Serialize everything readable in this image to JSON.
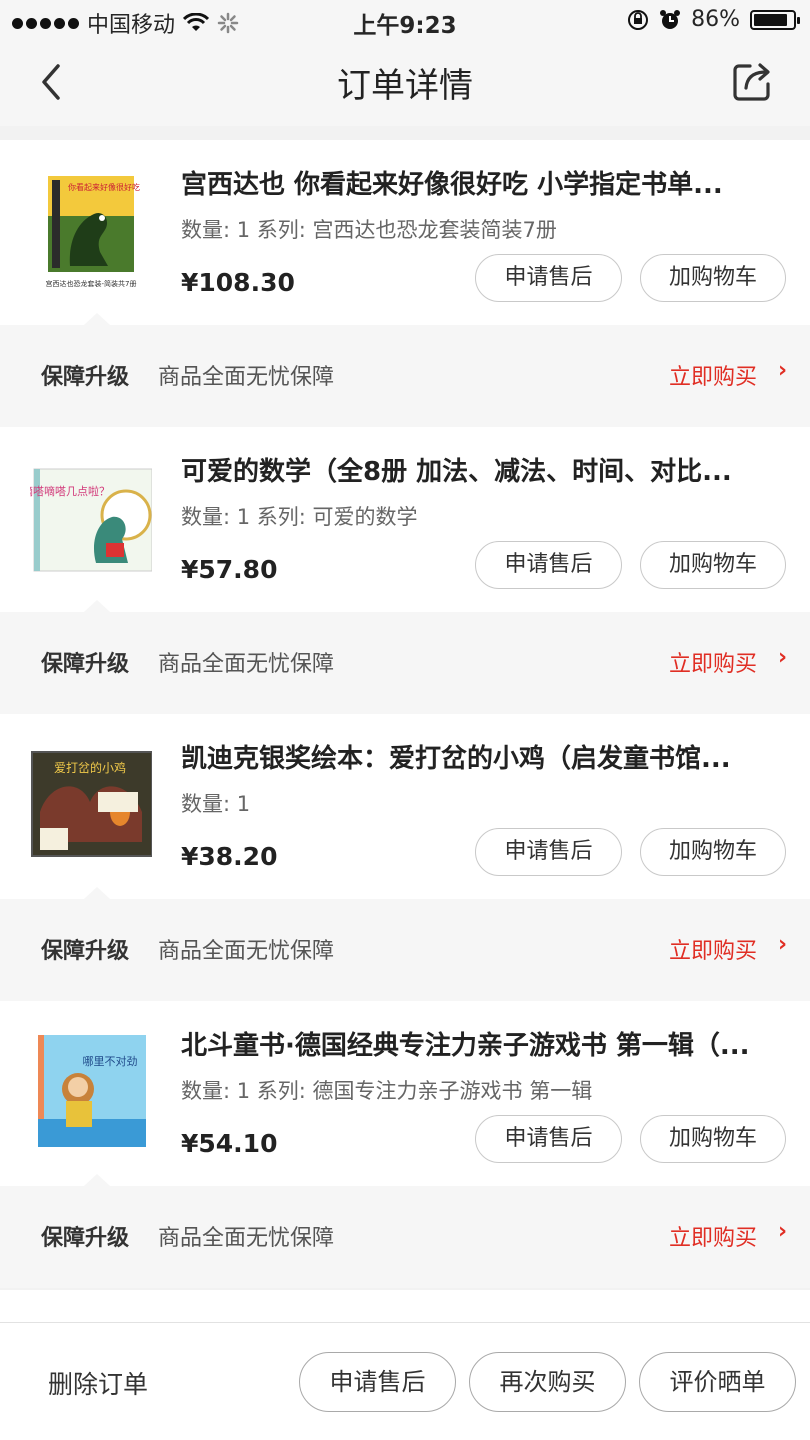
{
  "status": {
    "carrier": "中国移动",
    "time": "上午9:23",
    "battery": "86%",
    "battery_level": 0.86
  },
  "header": {
    "title": "订单详情"
  },
  "items": [
    {
      "name": "宫西达也 你看起来好像很好吃  小学指定书单...",
      "meta": "数量: 1 系列: 宫西达也恐龙套装简装7册",
      "price": "¥108.30",
      "thumb_caption": "宫西达也恐龙套装-简装共7册",
      "cover_text": "你看起来好像很好吃"
    },
    {
      "name": "可爱的数学（全8册 加法、减法、时间、对比...",
      "meta": "数量: 1 系列: 可爱的数学",
      "price": "¥57.80",
      "cover_text": "嘀嗒嘀嗒几点啦？"
    },
    {
      "name": "凯迪克银奖绘本：爱打岔的小鸡（启发童书馆...",
      "meta": "数量: 1",
      "price": "¥38.20",
      "cover_text": "爱打岔的小鸡"
    },
    {
      "name": "北斗童书·德国经典专注力亲子游戏书 第一辑（...",
      "meta": "数量: 1 系列: 德国专注力亲子游戏书 第一辑",
      "price": "¥54.10",
      "cover_text": "哪里不对劲"
    }
  ],
  "item_actions": {
    "after_sale": "申请售后",
    "add_cart": "加购物车"
  },
  "guarantee": {
    "label": "保障升级",
    "desc": "商品全面无忧保障",
    "buy": "立即购买"
  },
  "footer": {
    "delete": "删除订单",
    "after_sale": "申请售后",
    "rebuy": "再次购买",
    "review": "评价晒单"
  },
  "colors": {
    "accent": "#e02e24",
    "background": "#f2f2f2"
  }
}
